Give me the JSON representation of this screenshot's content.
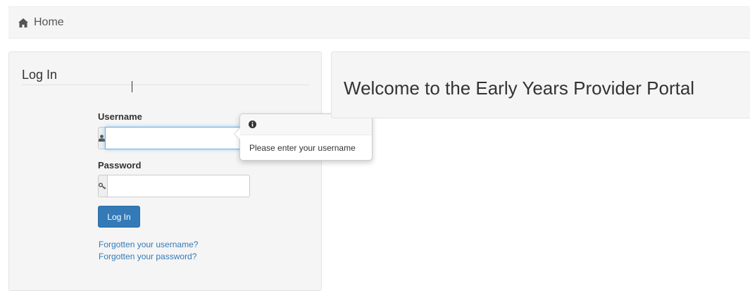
{
  "breadcrumb": {
    "home_label": "Home",
    "home_icon": "home-icon"
  },
  "login": {
    "title": "Log In",
    "username": {
      "label": "Username",
      "value": "",
      "icon": "user-icon"
    },
    "password": {
      "label": "Password",
      "value": "",
      "icon": "key-icon"
    },
    "submit_label": "Log In",
    "forgot_username": "Forgotten your username?",
    "forgot_password": "Forgotten your password?"
  },
  "popover": {
    "icon": "info-icon",
    "message": "Please enter your username"
  },
  "welcome": {
    "title": "Welcome to the Early Years Provider Portal"
  },
  "colors": {
    "primary": "#337ab7",
    "focus": "#66afe9",
    "panel_bg": "#f5f5f5"
  }
}
